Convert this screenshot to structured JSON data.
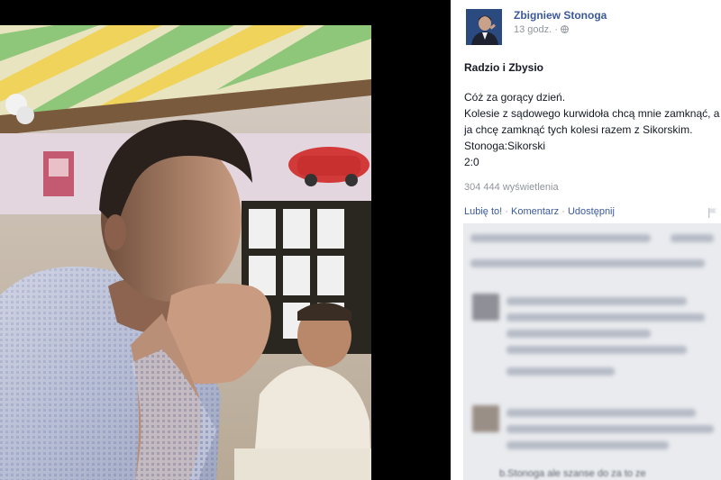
{
  "post": {
    "author": "Zbigniew Stonoga",
    "time": "13 godz.",
    "title": "Radzio i Zbysio",
    "body_lines": [
      "Cóż za gorący dzień.",
      "Kolesie z sądowego kurwidoła chcą mnie zamknąć, a",
      "ja chcę zamknąć tych kolesi razem z Sikorskim.",
      "Stonoga:Sikorski",
      "2:0"
    ],
    "views": "304 444 wyświetlenia",
    "actions": {
      "like": "Lubię to!",
      "comment": "Komentarz",
      "share": "Udostępnij",
      "separator": " · "
    }
  },
  "comments_visible_fragment": "b.Stonoga ale szanse do za to ze",
  "icons": [
    "globe-icon",
    "flag-icon"
  ],
  "colors": {
    "link": "#3b5998",
    "meta": "#90949c",
    "text": "#141823",
    "comments_bg": "#e9ebee"
  }
}
